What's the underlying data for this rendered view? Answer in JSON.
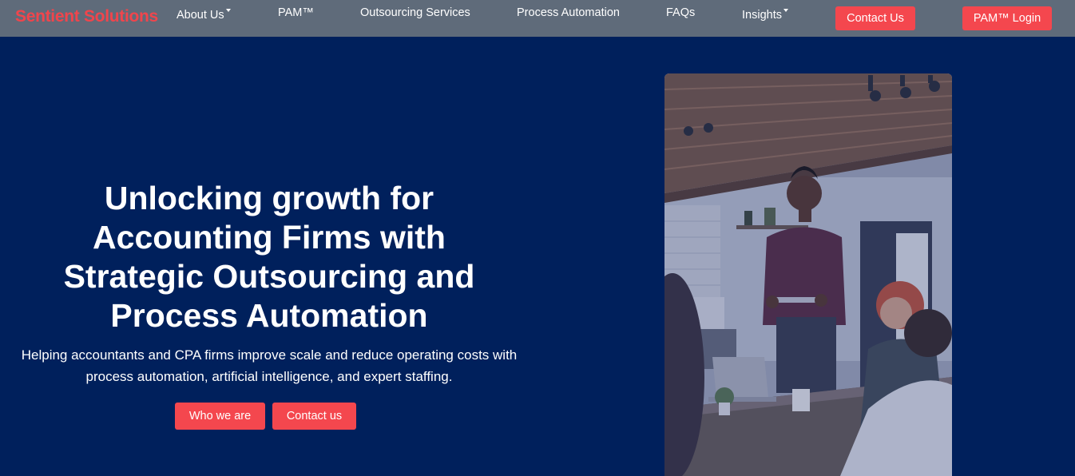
{
  "navbar": {
    "brand": "Sentient Solutions",
    "links": {
      "about": "About Us",
      "pam": "PAM™",
      "outsourcing": "Outsourcing Services",
      "automation": "Process Automation",
      "faqs": "FAQs",
      "insights": "Insights"
    },
    "contact_label": "Contact Us",
    "login_label": "PAM™ Login"
  },
  "hero": {
    "title_lines": [
      "Unlocking growth for",
      "Accounting Firms with",
      "Strategic Outsourcing and",
      "Process Automation"
    ],
    "subtitle_lines": [
      "Helping accountants and CPA firms improve scale and reduce operating costs with",
      "process automation, artificial intelligence, and expert staffing."
    ],
    "who_label": "Who we are",
    "contact_label": "Contact us"
  },
  "colors": {
    "hero_background": "#00205c",
    "navbar_background": "#5f6b7a",
    "accent": "#f4474e",
    "brand_text": "#f0454c",
    "text": "#ffffff"
  },
  "icons": [
    "chevron-down-icon"
  ]
}
